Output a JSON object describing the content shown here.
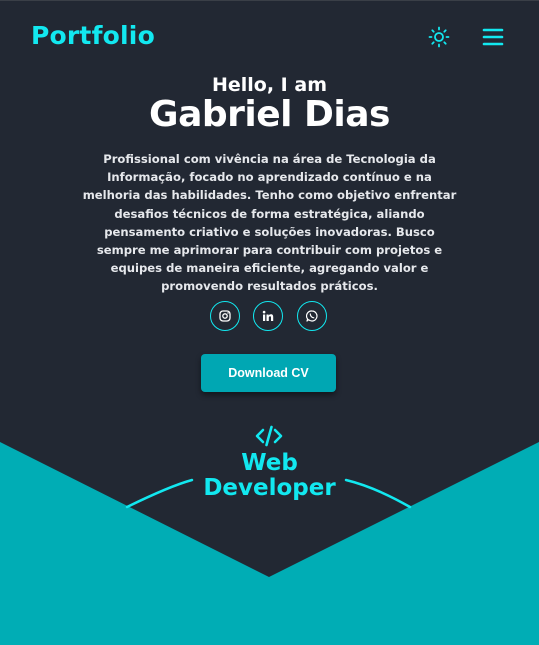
{
  "header": {
    "logo": "Portfolio",
    "theme_icon": "sun-icon",
    "menu_icon": "hamburger-menu-icon"
  },
  "hero": {
    "greeting": "Hello, I am",
    "name": "Gabriel Dias",
    "bio": "Profissional com vivência na área de Tecnologia da Informação, focado no aprendizado contínuo e na melhoria das habilidades. Tenho como objetivo enfrentar desafios técnicos de forma estratégica, aliando pensamento criativo e soluções inovadoras. Busco sempre me aprimorar para contribuir com projetos e equipes de maneira eficiente, agregando valor e promovendo resultados práticos.",
    "socials": [
      {
        "icon": "instagram-icon"
      },
      {
        "icon": "linkedin-icon"
      },
      {
        "icon": "whatsapp-icon"
      }
    ],
    "cta_label": "Download CV"
  },
  "role": {
    "icon": "code-icon",
    "line1": "Web",
    "line2": "Developer"
  },
  "colors": {
    "background": "#222833",
    "accent": "#12e8f0",
    "teal": "#00adb5",
    "button": "#00a7b3"
  }
}
